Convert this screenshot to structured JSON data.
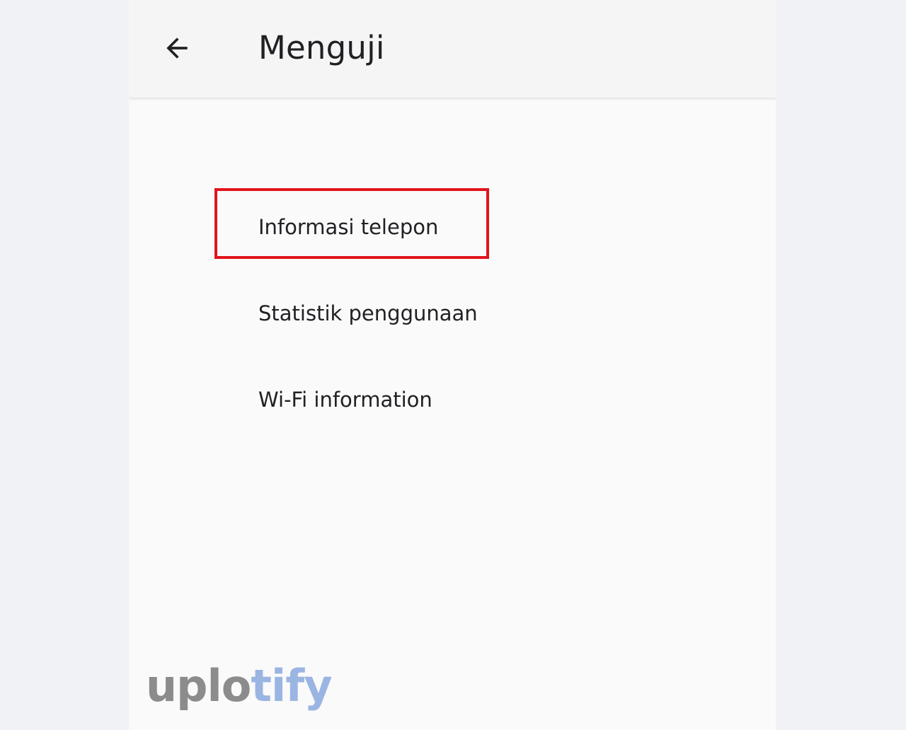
{
  "app_bar": {
    "back_icon": "arrow-back-icon",
    "title": "Menguji"
  },
  "menu": {
    "items": [
      {
        "label": "Informasi telepon",
        "highlighted": true
      },
      {
        "label": "Statistik penggunaan",
        "highlighted": false
      },
      {
        "label": "Wi-Fi information",
        "highlighted": false
      }
    ]
  },
  "annotation": {
    "highlight_color": "#e1141c"
  },
  "watermark": {
    "part1": "uplo",
    "part2": "tify",
    "part1_color": "#8c8c8c",
    "part2_color": "#9bb5e3"
  }
}
